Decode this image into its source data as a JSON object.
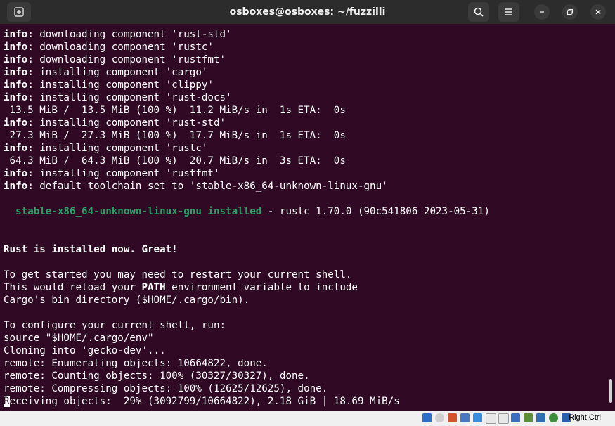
{
  "window": {
    "title": "osboxes@osboxes: ~/fuzzilli"
  },
  "terminal": {
    "lines": [
      [
        {
          "t": "info:",
          "s": "b"
        },
        {
          "t": " downloading component 'rust-std'"
        }
      ],
      [
        {
          "t": "info:",
          "s": "b"
        },
        {
          "t": " downloading component 'rustc'"
        }
      ],
      [
        {
          "t": "info:",
          "s": "b"
        },
        {
          "t": " downloading component 'rustfmt'"
        }
      ],
      [
        {
          "t": "info:",
          "s": "b"
        },
        {
          "t": " installing component 'cargo'"
        }
      ],
      [
        {
          "t": "info:",
          "s": "b"
        },
        {
          "t": " installing component 'clippy'"
        }
      ],
      [
        {
          "t": "info:",
          "s": "b"
        },
        {
          "t": " installing component 'rust-docs'"
        }
      ],
      [
        {
          "t": " 13.5 MiB /  13.5 MiB (100 %)  11.2 MiB/s in  1s ETA:  0s"
        }
      ],
      [
        {
          "t": "info:",
          "s": "b"
        },
        {
          "t": " installing component 'rust-std'"
        }
      ],
      [
        {
          "t": " 27.3 MiB /  27.3 MiB (100 %)  17.7 MiB/s in  1s ETA:  0s"
        }
      ],
      [
        {
          "t": "info:",
          "s": "b"
        },
        {
          "t": " installing component 'rustc'"
        }
      ],
      [
        {
          "t": " 64.3 MiB /  64.3 MiB (100 %)  20.7 MiB/s in  3s ETA:  0s"
        }
      ],
      [
        {
          "t": "info:",
          "s": "b"
        },
        {
          "t": " installing component 'rustfmt'"
        }
      ],
      [
        {
          "t": "info:",
          "s": "b"
        },
        {
          "t": " default toolchain set to 'stable-x86_64-unknown-linux-gnu'"
        }
      ],
      [
        {
          "t": ""
        }
      ],
      [
        {
          "t": "  "
        },
        {
          "t": "stable-x86_64-unknown-linux-gnu installed",
          "s": "g"
        },
        {
          "t": " - rustc 1.70.0 (90c541806 2023-05-31)"
        }
      ],
      [
        {
          "t": ""
        }
      ],
      [
        {
          "t": ""
        }
      ],
      [
        {
          "t": "Rust is installed now. Great!",
          "s": "b"
        }
      ],
      [
        {
          "t": ""
        }
      ],
      [
        {
          "t": "To get started you may need to restart your current shell."
        }
      ],
      [
        {
          "t": "This would reload your "
        },
        {
          "t": "PATH",
          "s": "b"
        },
        {
          "t": " environment variable to include"
        }
      ],
      [
        {
          "t": "Cargo's bin directory ($HOME/.cargo/bin)."
        }
      ],
      [
        {
          "t": ""
        }
      ],
      [
        {
          "t": "To configure your current shell, run:"
        }
      ],
      [
        {
          "t": "source \"$HOME/.cargo/env\""
        }
      ],
      [
        {
          "t": "Cloning into 'gecko-dev'..."
        }
      ],
      [
        {
          "t": "remote: Enumerating objects: 10664822, done."
        }
      ],
      [
        {
          "t": "remote: Counting objects: 100% (30327/30327), done."
        }
      ],
      [
        {
          "t": "remote: Compressing objects: 100% (12625/12625), done."
        }
      ],
      [
        {
          "t": "R",
          "s": "cursor"
        },
        {
          "t": "eceiving objects:  29% (3092799/10664822), 2.18 GiB | 18.69 MiB/s"
        }
      ]
    ]
  },
  "statusbar": {
    "host_key": "Right Ctrl"
  },
  "icons": {
    "new_tab": "new-tab-icon",
    "search": "search-icon",
    "menu": "hamburger-menu-icon",
    "minimize": "minimize-icon",
    "maximize": "maximize-icon",
    "close": "close-icon"
  },
  "colors": {
    "terminal_bg": "#300a24",
    "titlebar_bg": "#2c2c2c",
    "green": "#26a269"
  }
}
